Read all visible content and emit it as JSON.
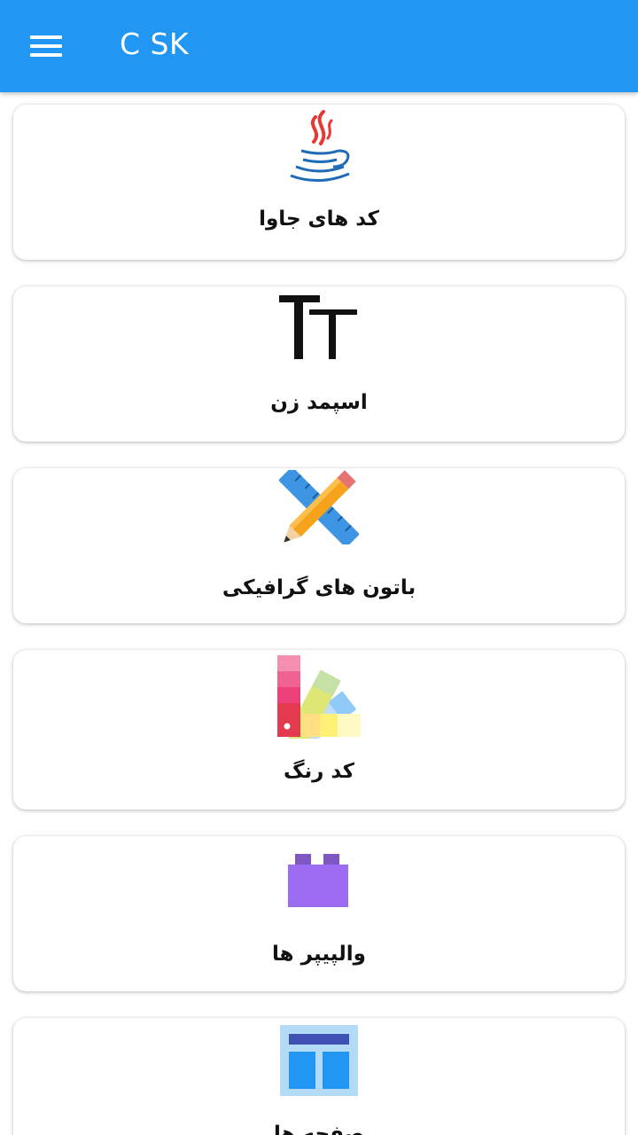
{
  "app_bar": {
    "title": "C SK",
    "menu_icon": "menu-icon"
  },
  "cards": [
    {
      "label": "کد های جاوا",
      "icon": "java-icon"
    },
    {
      "label": "اسپمد زن",
      "icon": "text-size-icon"
    },
    {
      "label": "باتون های گرافیکی",
      "icon": "pencil-ruler-icon"
    },
    {
      "label": "کد رنگ",
      "icon": "color-palette-icon"
    },
    {
      "label": "والپیپر ها",
      "icon": "lego-block-icon"
    },
    {
      "label": "صفحه ها",
      "icon": "layout-icon"
    }
  ],
  "colors": {
    "app_bar": "#2196F3",
    "card_background": "#ffffff",
    "page_background": "#ffffff"
  }
}
